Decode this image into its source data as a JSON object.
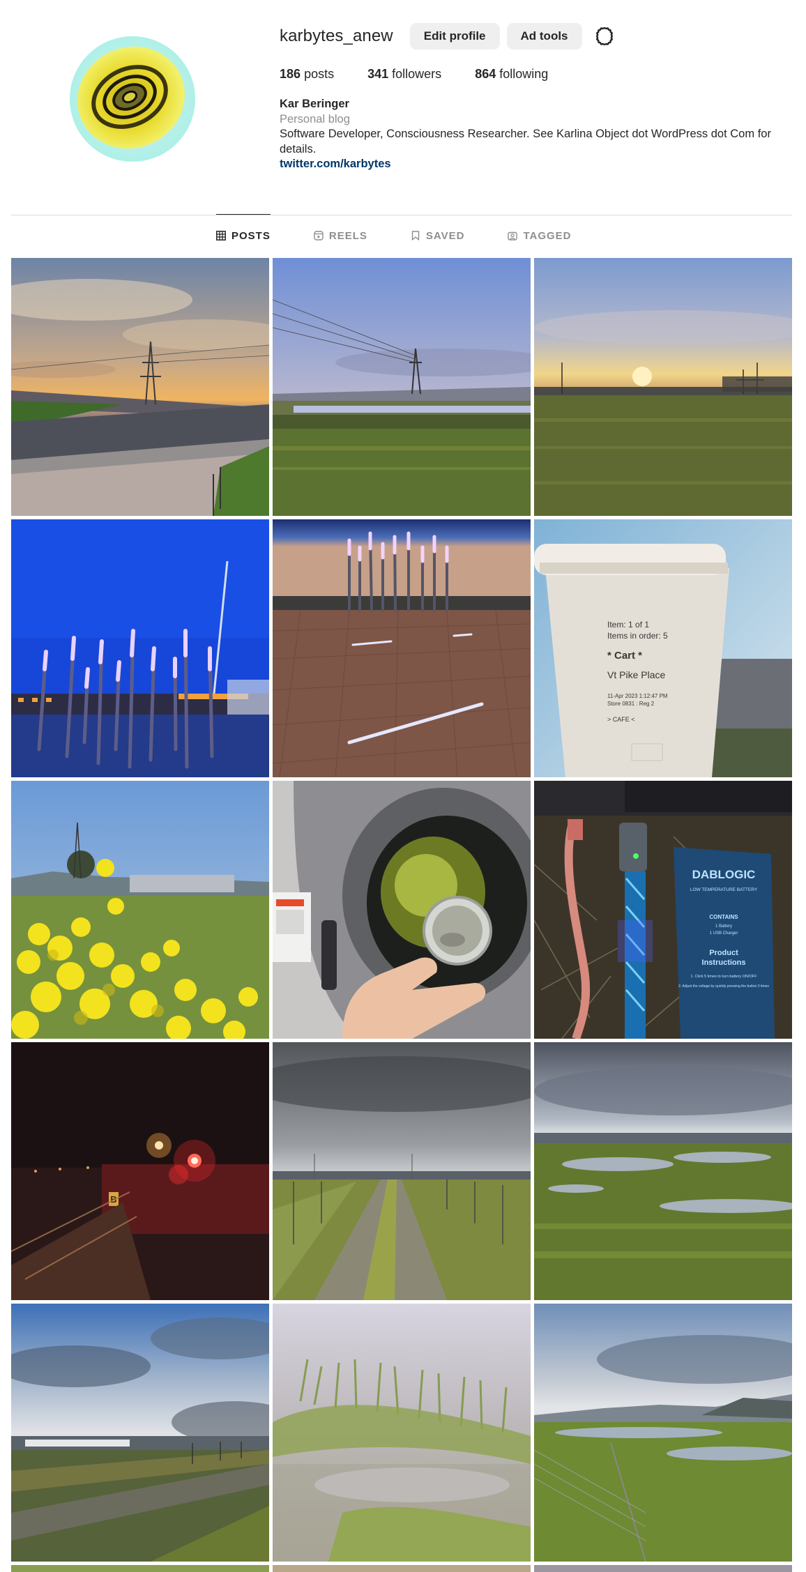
{
  "profile": {
    "username": "karbytes_anew",
    "edit_profile_label": "Edit profile",
    "ad_tools_label": "Ad tools",
    "settings_icon": "gear-icon"
  },
  "stats": {
    "posts_count": "186",
    "posts_label": "posts",
    "followers_count": "341",
    "followers_label": "followers",
    "following_count": "864",
    "following_label": "following"
  },
  "bio": {
    "name": "Kar Beringer",
    "category": "Personal blog",
    "text": "Software Developer, Consciousness Researcher. See Karlina Object dot WordPress dot Com for details.",
    "link": "twitter.com/karbytes"
  },
  "tabs": [
    {
      "label": "POSTS",
      "icon": "grid-icon",
      "active": true
    },
    {
      "label": "REELS",
      "icon": "reels-icon",
      "active": false
    },
    {
      "label": "SAVED",
      "icon": "bookmark-icon",
      "active": false
    },
    {
      "label": "TAGGED",
      "icon": "tagged-icon",
      "active": false
    }
  ],
  "colors": {
    "link": "#00376b",
    "button_bg": "#efefef",
    "muted": "#8e8e8e",
    "divider": "#dbdbdb"
  },
  "posts": {
    "cup_lines": [
      "Item: 1 of 1",
      "Items in order: 5",
      "* Cart *",
      "Vt Pike Place",
      "11-Apr 2023  1:12:47 PM",
      "Store 0831 : Reg 2",
      "> CAFE <"
    ],
    "battery_brand": "DABLOGIC",
    "battery_sub": "LOW TEMPERATURE BATTERY",
    "battery_contains": "CONTAINS",
    "battery_items": [
      "1 Battery",
      "1 USB Charger"
    ],
    "battery_product": "Product",
    "battery_instructions": "Instructions",
    "battery_steps": [
      "1. Click 5 times to turn battery ON/OFF",
      "2. Adjust the voltage by quickly pressing the button 3 times"
    ],
    "parking_sign": "B"
  }
}
